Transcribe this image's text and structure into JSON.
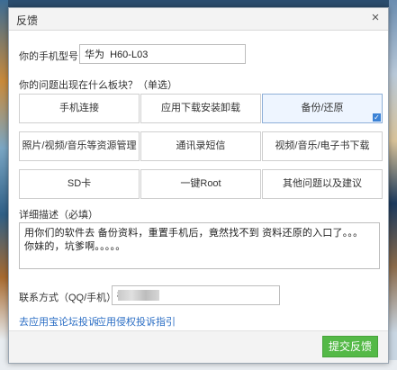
{
  "dialog": {
    "title": "反馈",
    "close_glyph": "×",
    "phone_model_label": "你的手机型号：",
    "phone_model_value": "华为  H60-L03",
    "section_label": "你的问题出现在什么板块？（单选）",
    "options": [
      {
        "label": "手机连接",
        "selected": false
      },
      {
        "label": "应用下载安装卸载",
        "selected": false
      },
      {
        "label": "备份/还原",
        "selected": true
      },
      {
        "label": "照片/视频/音乐等资源管理",
        "selected": false
      },
      {
        "label": "通讯录短信",
        "selected": false
      },
      {
        "label": "视频/音乐/电子书下载",
        "selected": false
      },
      {
        "label": "SD卡",
        "selected": false
      },
      {
        "label": "一键Root",
        "selected": false
      },
      {
        "label": "其他问题以及建议",
        "selected": false
      }
    ],
    "check_glyph": "✓",
    "description_label": "详细描述（必填）",
    "description_value": "用你们的软件去 备份资料，重置手机后，竟然找不到 资料还原的入口了。。。 你妹的，坑爹啊。。。。。",
    "contact_label": "联系方式（QQ/手机）：",
    "contact_value": "8           3",
    "link_complaint": "去应用宝论坛投诉",
    "link_infringement": "应用侵权投诉指引",
    "submit_label": "提交反馈",
    "colors": {
      "submit_green": "#54b947",
      "link_blue": "#2a6dc4",
      "selected_blue": "#3b82d6"
    }
  }
}
